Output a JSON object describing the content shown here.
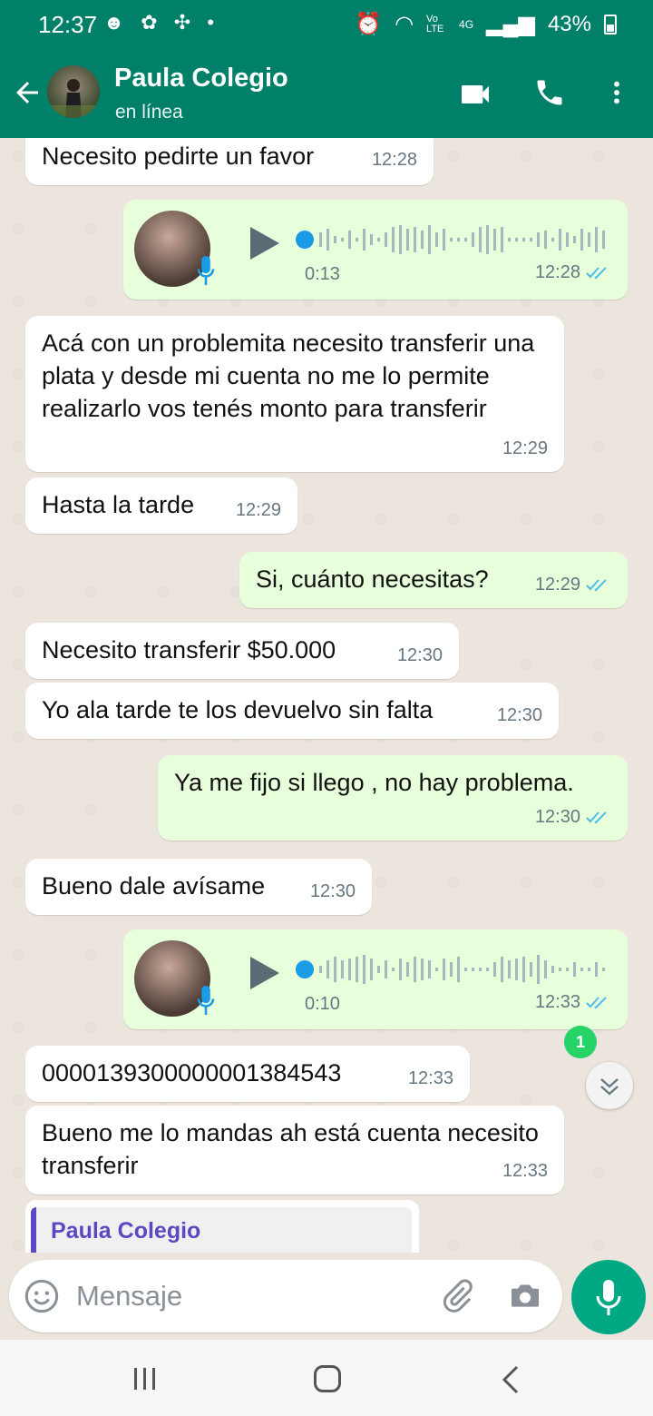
{
  "status_bar": {
    "time": "12:37",
    "battery": "43%",
    "network": "4G",
    "volte": "Vo LTE"
  },
  "header": {
    "contact_name": "Paula Colegio",
    "status": "en línea",
    "icons": [
      "back-arrow-icon",
      "video-call-icon",
      "phone-icon",
      "more-vert-icon"
    ]
  },
  "messages": [
    {
      "dir": "in",
      "text": "Necesito pedirte un favor",
      "time": "12:28"
    },
    {
      "dir": "out",
      "type": "voice",
      "duration": "0:13",
      "time": "12:28",
      "read": true
    },
    {
      "dir": "in",
      "text": "Acá con un problemita necesito transferir una plata y desde mi cuenta no me lo permite realizarlo vos tenés monto para transferir",
      "time": "12:29"
    },
    {
      "dir": "in",
      "text": "Hasta la tarde",
      "time": "12:29"
    },
    {
      "dir": "out",
      "text": "Si, cuánto  necesitas?",
      "time": "12:29",
      "read": true
    },
    {
      "dir": "in",
      "text": "Necesito transferir $50.000",
      "time": "12:30"
    },
    {
      "dir": "in",
      "text": "Yo ala tarde te los devuelvo sin falta",
      "time": "12:30"
    },
    {
      "dir": "out",
      "text": "Ya me fijo si llego , no hay problema.",
      "time": "12:30",
      "read": true
    },
    {
      "dir": "in",
      "text": "Bueno dale avísame",
      "time": "12:30"
    },
    {
      "dir": "out",
      "type": "voice",
      "duration": "0:10",
      "time": "12:33",
      "read": true
    },
    {
      "dir": "in",
      "text": "0000139300000001384543",
      "time": "12:33"
    },
    {
      "dir": "in",
      "text": "Bueno me lo mandas ah está cuenta necesito transferir",
      "time": "12:33"
    }
  ],
  "unread_badge": "1",
  "quoted_preview": {
    "name": "Paula Colegio"
  },
  "composer": {
    "placeholder": "Mensaje"
  },
  "colors": {
    "header": "#008069",
    "outgoing": "#e7ffdb",
    "incoming": "#ffffff",
    "mic": "#00a884",
    "ticks": "#53bdeb",
    "quote_accent": "#5b48c2"
  }
}
